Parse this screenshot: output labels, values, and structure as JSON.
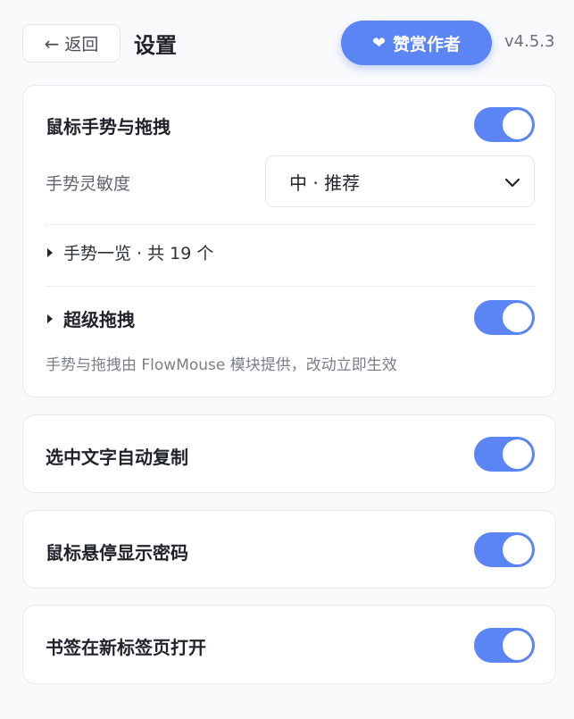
{
  "header": {
    "back_label": "返回",
    "back_arrow": "←",
    "title": "设置",
    "donate_label": "赞赏作者",
    "donate_icon": "❤",
    "version": "v4.5.3"
  },
  "gesture_card": {
    "title": "鼠标手势与拖拽",
    "enabled": true,
    "sensitivity_label": "手势灵敏度",
    "sensitivity_value": "中 · 推荐",
    "gesture_list_label": "手势一览 · 共 19 个",
    "super_drag_label": "超级拖拽",
    "super_drag_enabled": true,
    "hint": "手势与拖拽由 FlowMouse 模块提供，改动立即生效"
  },
  "settings": [
    {
      "label": "选中文字自动复制",
      "enabled": true
    },
    {
      "label": "鼠标悬停显示密码",
      "enabled": true
    },
    {
      "label": "书签在新标签页打开",
      "enabled": true
    }
  ],
  "colors": {
    "accent": "#5b84f5",
    "background": "#f9fafb"
  }
}
